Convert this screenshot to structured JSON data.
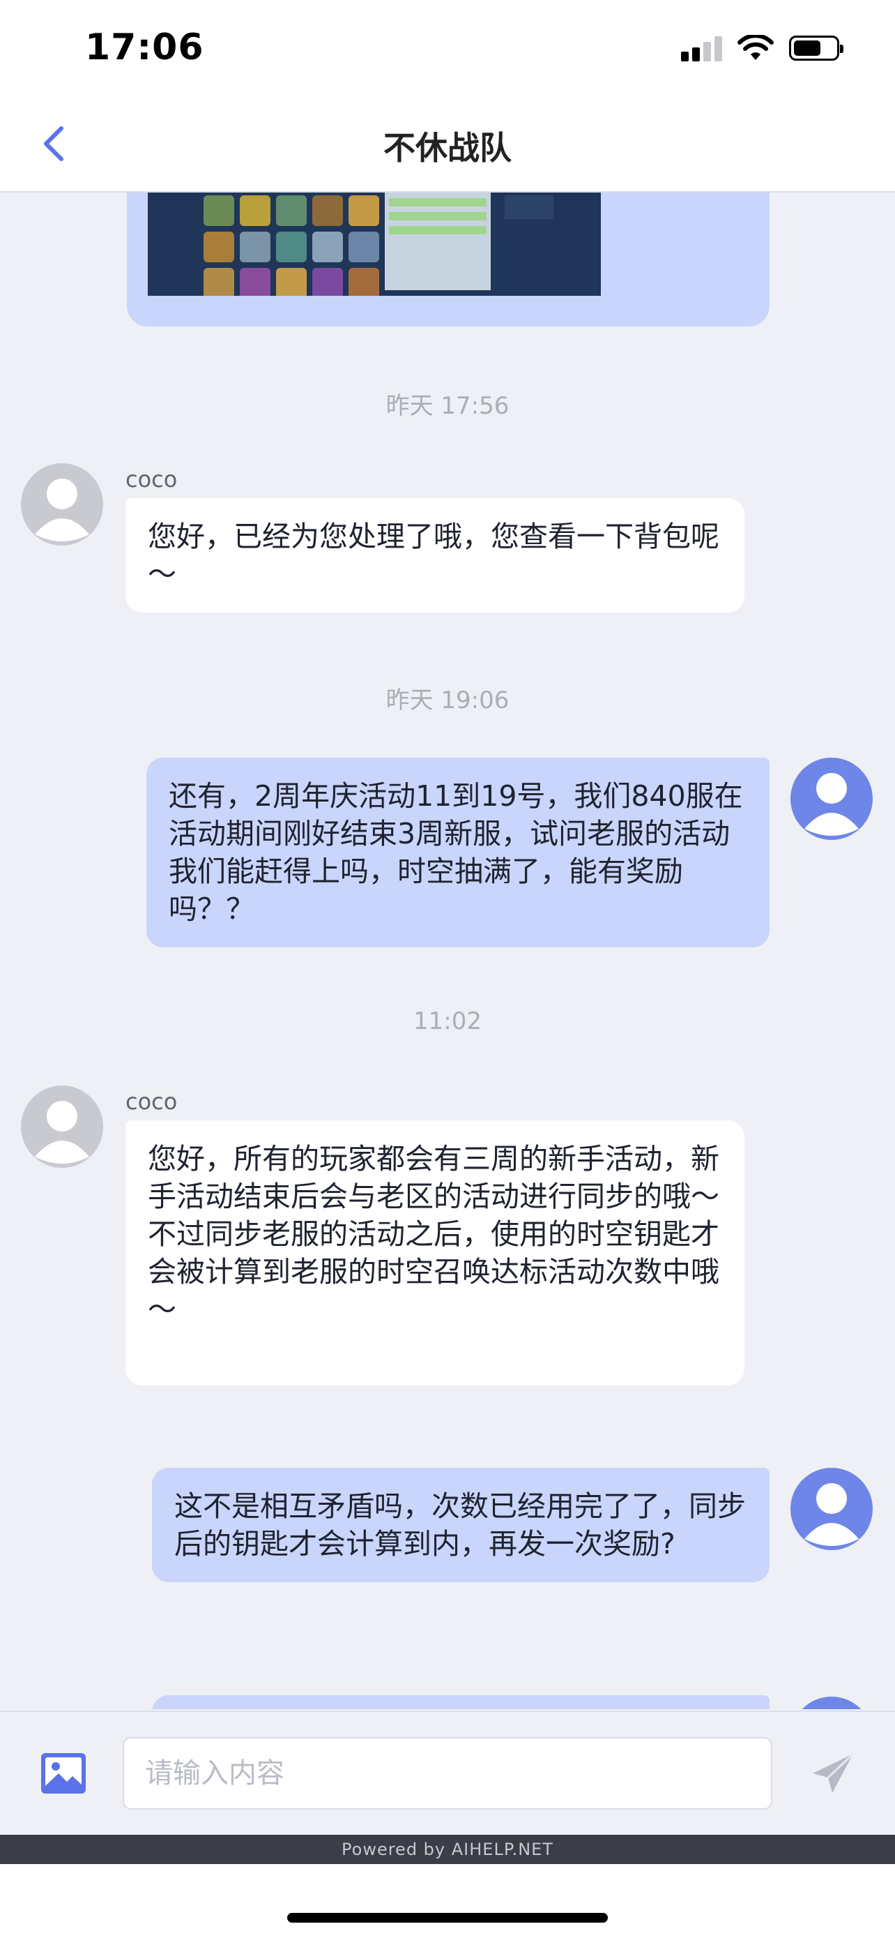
{
  "status_bar": {
    "time": "17:06",
    "signal_icon": "cellular-signal-icon",
    "wifi_icon": "wifi-icon",
    "battery_icon": "battery-icon",
    "battery_level": 0.6
  },
  "nav": {
    "title": "不休战队",
    "back_icon": "chevron-left-icon"
  },
  "messages": [
    {
      "type": "image",
      "from": "user"
    },
    {
      "type": "timestamp",
      "text": "昨天 17:56"
    },
    {
      "type": "text",
      "from": "agent",
      "sender": "coco",
      "text": "您好，已经为您处理了哦，您查看一下背包呢～"
    },
    {
      "type": "timestamp",
      "text": "昨天 19:06"
    },
    {
      "type": "text",
      "from": "user",
      "text": "还有，2周年庆活动11到19号，我们840服在活动期间刚好结束3周新服，试问老服的活动我们能赶得上吗，时空抽满了，能有奖励吗？？"
    },
    {
      "type": "timestamp",
      "text": "11:02"
    },
    {
      "type": "text",
      "from": "agent",
      "sender": "coco",
      "text": "您好，所有的玩家都会有三周的新手活动，新手活动结束后会与老区的活动进行同步的哦～不过同步老服的活动之后，使用的时空钥匙才会被计算到老服的时空召唤达标活动次数中哦～"
    },
    {
      "type": "text",
      "from": "user",
      "text": "这不是相互矛盾吗，次数已经用完了了，同步后的钥匙才会计算到内，再发一次奖励?"
    }
  ],
  "input": {
    "placeholder": "请输入内容",
    "value": "",
    "image_icon": "image-icon",
    "send_icon": "send-icon"
  },
  "footer": {
    "powered_by": "Powered by AIHELP.NET"
  },
  "colors": {
    "agent_bubble": "#ffffff",
    "user_bubble": "#c9d5fb",
    "accent": "#5b72e8",
    "background": "#eef0f5"
  }
}
